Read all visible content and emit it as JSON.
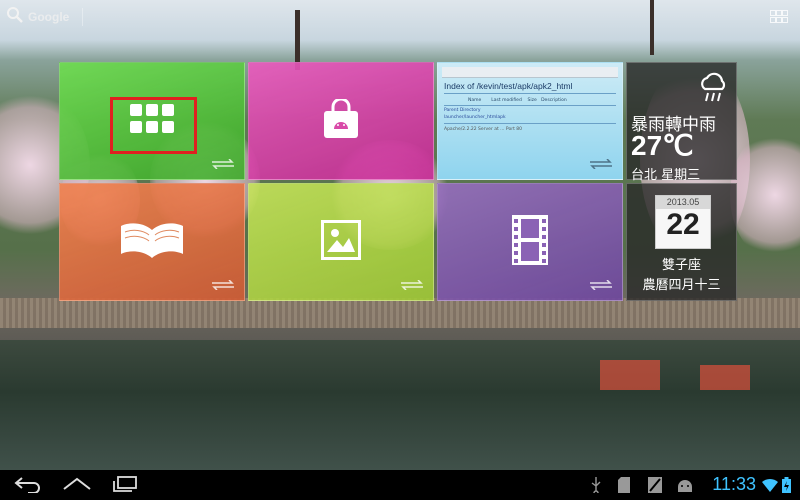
{
  "top_bar": {
    "search_label": "Google"
  },
  "tiles": {
    "apps": {
      "icon": "app-grid-icon"
    },
    "store": {
      "icon": "shopping-bag-android-icon"
    },
    "browser": {
      "page_title": "Index of /kevin/test/apk/apk2_html",
      "columns": [
        "Name",
        "Last modified",
        "Size",
        "Description"
      ],
      "rows": [
        "Parent Directory",
        "launcher/launcher_htmlapk",
        "Apache/2.2.22 Server at ... Port 80"
      ]
    },
    "books": {
      "icon": "open-book-icon"
    },
    "gallery": {
      "icon": "picture-icon"
    },
    "video": {
      "icon": "film-strip-icon"
    },
    "weather": {
      "condition": "暴雨轉中雨",
      "temperature": "27℃",
      "city_day": "台北 星期三",
      "icon": "rain-cloud-icon"
    },
    "calendar": {
      "year_month": "2013.05",
      "day": "22",
      "zodiac": "雙子座",
      "lunar_date": "農曆四月十三"
    }
  },
  "status_bar": {
    "time": "11:33",
    "time_color": "#3fc3ff",
    "icons": [
      "usb-icon",
      "sd-card-icon",
      "screenshot-icon",
      "android-debug-icon",
      "wifi-icon",
      "battery-icon"
    ]
  },
  "highlight_color": "#e02020"
}
